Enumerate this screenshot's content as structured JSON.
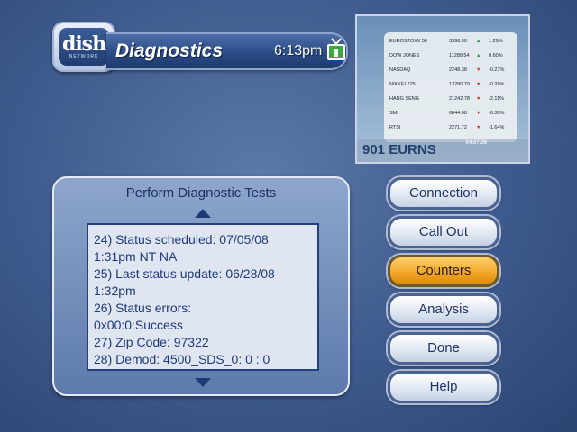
{
  "header": {
    "logo_text": "dish",
    "logo_subtext": "NETWORK",
    "title": "Diagnostics",
    "time": "6:13pm",
    "tv_icon": "tv-icon"
  },
  "preview": {
    "channel": "901 EURNS",
    "date": "04.07.08",
    "tickers": [
      {
        "name": "EUROSTOXX 50",
        "value": "3398.90",
        "change": "1.29%",
        "direction": "up"
      },
      {
        "name": "DOW JONES",
        "value": "11288.54",
        "change": "0.60%",
        "direction": "up"
      },
      {
        "name": "NASDAQ",
        "value": "2248.38",
        "change": "-0.27%",
        "direction": "down"
      },
      {
        "name": "NIKKEI 225",
        "value": "13280.79",
        "change": "-0.26%",
        "direction": "down"
      },
      {
        "name": "HANG SENG",
        "value": "21242.78",
        "change": "-2.11%",
        "direction": "down"
      },
      {
        "name": "SMI",
        "value": "6844.08",
        "change": "-0.38%",
        "direction": "down"
      },
      {
        "name": "RTSI",
        "value": "2271.72",
        "change": "-1.64%",
        "direction": "down"
      }
    ]
  },
  "diagnostics": {
    "heading": "Perform Diagnostic Tests",
    "lines": [
      "24) Status scheduled: 07/05/08",
      "1:31pm NT NA",
      "25) Last status update: 06/28/08",
      "1:32pm",
      "26) Status errors:",
      "0x00:0:Success",
      "27) Zip Code: 97322",
      "28) Demod: 4500_SDS_0: 0 : 0"
    ]
  },
  "menu": {
    "items": [
      {
        "label": "Connection",
        "active": false
      },
      {
        "label": "Call Out",
        "active": false
      },
      {
        "label": "Counters",
        "active": true
      },
      {
        "label": "Analysis",
        "active": false
      },
      {
        "label": "Done",
        "active": false
      },
      {
        "label": "Help",
        "active": false
      }
    ]
  },
  "colors": {
    "background": "#3e5a8c",
    "accent_active": "#f0a426",
    "text_dark_blue": "#1f3a78",
    "ticker_up": "#2a9a3a",
    "ticker_down": "#c8321e"
  }
}
